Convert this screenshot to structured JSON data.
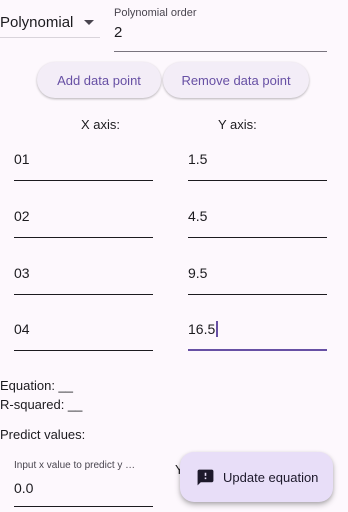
{
  "top": {
    "regression_type": "Polynomial",
    "order_label": "Polynomial order",
    "order_value": "2"
  },
  "buttons": {
    "add": "Add data point",
    "remove": "Remove data point"
  },
  "headers": {
    "x": "X axis:",
    "y": "Y axis:"
  },
  "points": [
    {
      "x": "01",
      "y": "1.5"
    },
    {
      "x": "02",
      "y": "4.5"
    },
    {
      "x": "03",
      "y": "9.5"
    },
    {
      "x": "04",
      "y": "16.5"
    }
  ],
  "results": {
    "equation": "Equation: __",
    "r_squared": "R-squared: __",
    "predict_title": "Predict values:"
  },
  "predict": {
    "input_label": "Input x value to predict y …",
    "input_value": "0.0",
    "y_partial": "Y"
  },
  "fab": {
    "label": "Update equation",
    "icon": "feedback-icon"
  },
  "colors": {
    "background": "#fdf8fd",
    "primary": "#6750a4",
    "button_bg": "#f3edf7",
    "fab_bg": "#e8def8"
  }
}
